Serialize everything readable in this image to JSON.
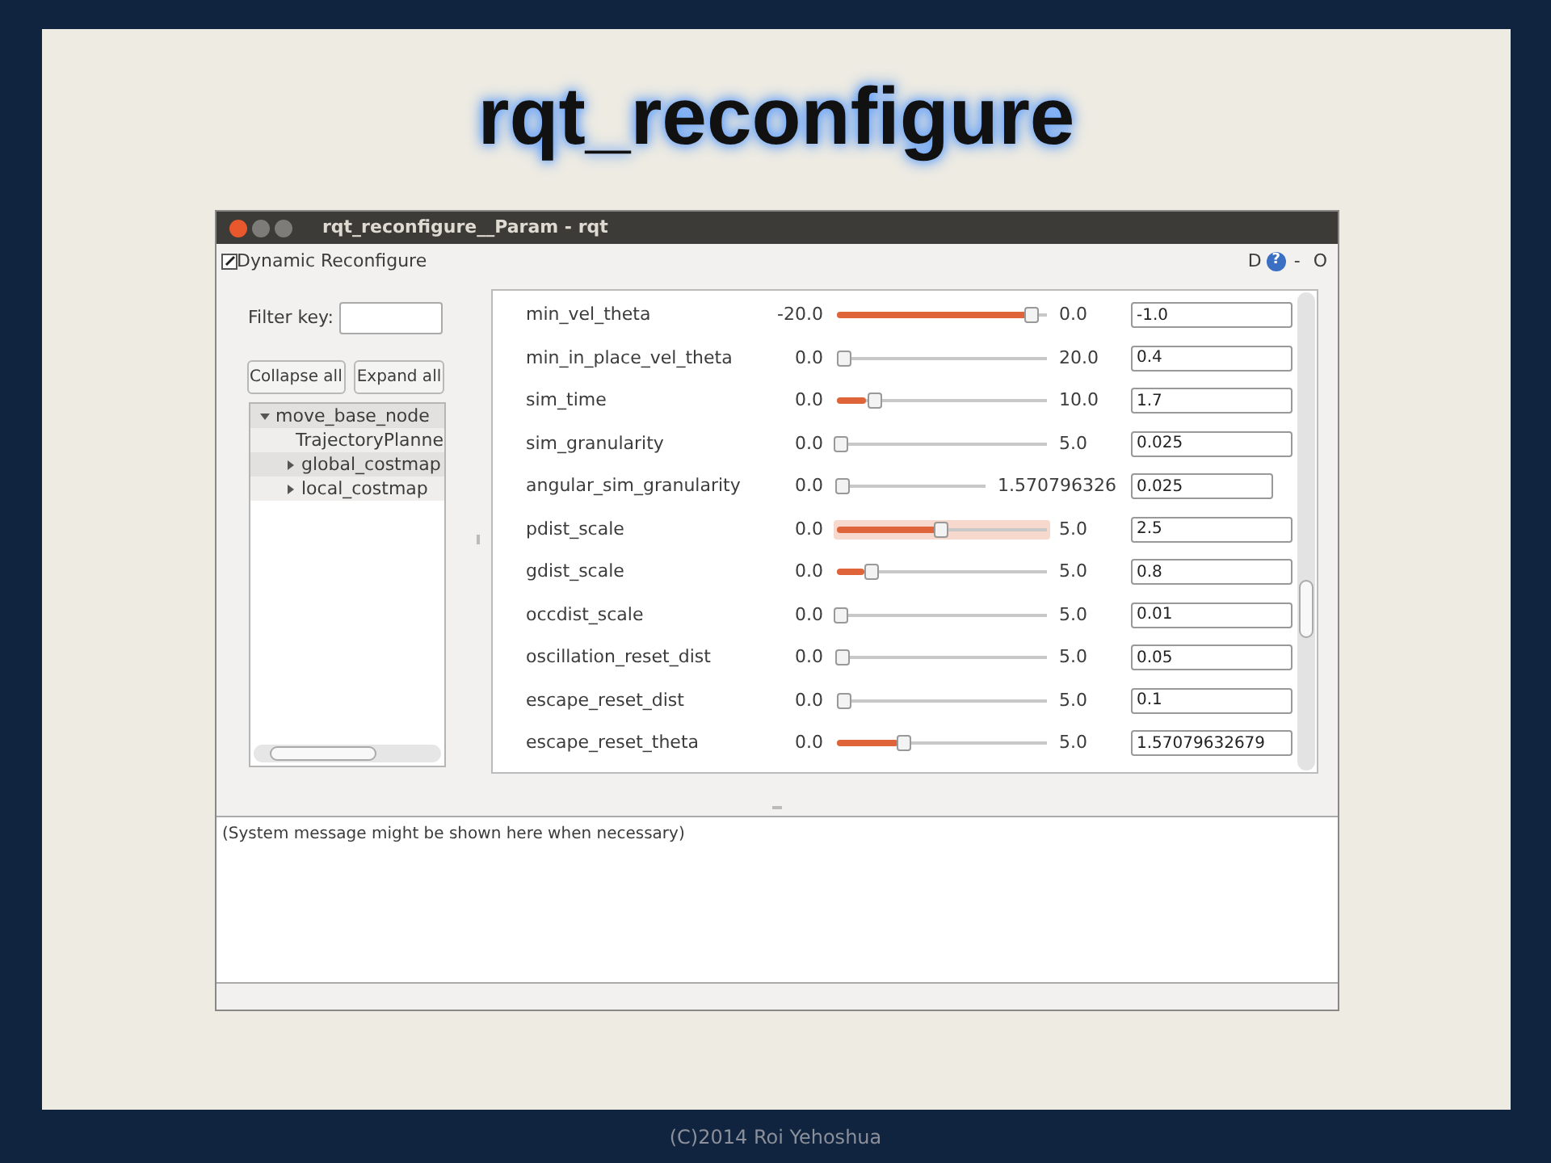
{
  "slide": {
    "title": "rqt_reconfigure",
    "footer": "(C)2014 Roi Yehoshua"
  },
  "window": {
    "title": "rqt_reconfigure__Param - rqt",
    "plugin_title": "Dynamic Reconfigure",
    "plugin_buttons": [
      "D",
      "?",
      "-",
      "O"
    ]
  },
  "filter": {
    "label": "Filter key:"
  },
  "buttons": [
    "Collapse all",
    "Expand all"
  ],
  "tree": [
    {
      "label": "move_base_node",
      "expanded": true,
      "children": [
        {
          "label": "TrajectoryPlanne"
        },
        {
          "label": "global_costmap",
          "expanded": false
        },
        {
          "label": "local_costmap",
          "expanded": false
        }
      ]
    }
  ],
  "params": [
    {
      "name": "min_vel_theta",
      "min": "-20.0",
      "max": "0.0",
      "level": 0.95,
      "value": "-1.0",
      "focused": false
    },
    {
      "name": "min_in_place_vel_theta",
      "min": "0.0",
      "max": "20.0",
      "level": 0.02,
      "value": "0.4",
      "focused": false
    },
    {
      "name": "sim_time",
      "min": "0.0",
      "max": "10.0",
      "level": 0.17,
      "value": "1.7",
      "focused": false
    },
    {
      "name": "sim_granularity",
      "min": "0.0",
      "max": "5.0",
      "level": 0.005,
      "value": "0.025",
      "focused": false
    },
    {
      "name": "angular_sim_granularity",
      "min": "0.0",
      "max": "1.570796326",
      "level": 0.016,
      "value": "0.025",
      "focused": false
    },
    {
      "name": "pdist_scale",
      "min": "0.0",
      "max": "5.0",
      "level": 0.5,
      "value": "2.5",
      "focused": true
    },
    {
      "name": "gdist_scale",
      "min": "0.0",
      "max": "5.0",
      "level": 0.16,
      "value": "0.8",
      "focused": false
    },
    {
      "name": "occdist_scale",
      "min": "0.0",
      "max": "5.0",
      "level": 0.002,
      "value": "0.01",
      "focused": false
    },
    {
      "name": "oscillation_reset_dist",
      "min": "0.0",
      "max": "5.0",
      "level": 0.01,
      "value": "0.05",
      "focused": false
    },
    {
      "name": "escape_reset_dist",
      "min": "0.0",
      "max": "5.0",
      "level": 0.02,
      "value": "0.1",
      "focused": false
    },
    {
      "name": "escape_reset_theta",
      "min": "0.0",
      "max": "5.0",
      "level": 0.314,
      "value": "1.57079632679",
      "focused": false
    }
  ],
  "message": "(System message might be shown here when necessary)"
}
